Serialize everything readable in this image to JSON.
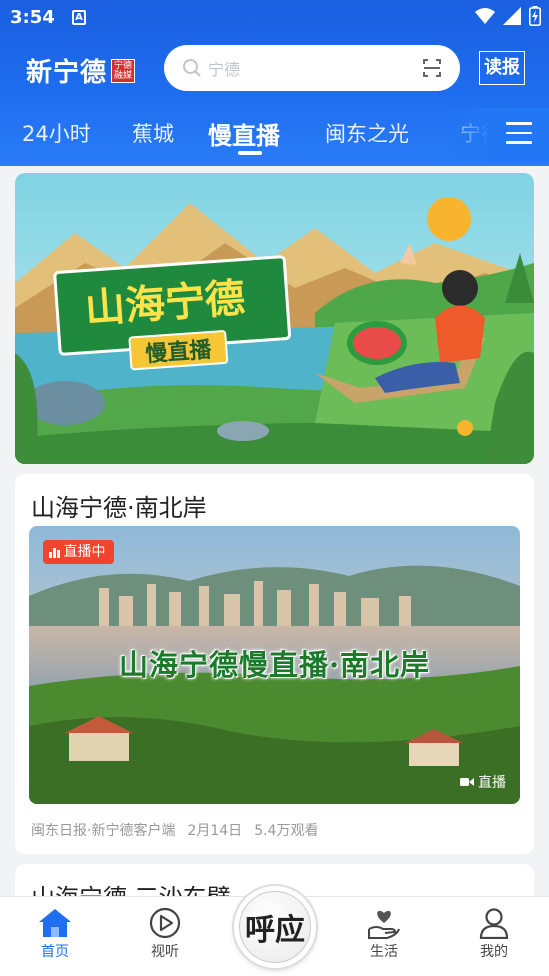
{
  "status_bar": {
    "time": "3:54",
    "notif_letter": "A"
  },
  "header": {
    "logo_text": "新宁德",
    "logo_seal": "宁德融媒",
    "search_placeholder": "宁德",
    "read_paper_label": "读报"
  },
  "tabs": [
    {
      "label": "24小时",
      "active": false
    },
    {
      "label": "蕉城",
      "active": false
    },
    {
      "label": "慢直播",
      "active": true
    },
    {
      "label": "闽东之光",
      "active": false
    },
    {
      "label": "宁德",
      "active": false
    }
  ],
  "banner": {
    "title": "山海宁德",
    "subtitle": "慢直播"
  },
  "feed": [
    {
      "title": "山海宁德·南北岸",
      "live_badge": "直播中",
      "thumb_caption": "山海宁德慢直播·南北岸",
      "video_badge": "直播",
      "source": "闽东日报·新宁德客户端",
      "date": "2月14日",
      "views": "5.4万观看"
    },
    {
      "title": "山海宁德·三沙东壁"
    }
  ],
  "bottom_nav": [
    {
      "label": "首页",
      "icon": "home-icon",
      "active": true
    },
    {
      "label": "视听",
      "icon": "play-circle-icon",
      "active": false
    },
    {
      "label": "呼应",
      "icon": "huying-center-icon",
      "active": false
    },
    {
      "label": "生活",
      "icon": "hand-heart-icon",
      "active": false
    },
    {
      "label": "我的",
      "icon": "user-icon",
      "active": false
    }
  ],
  "colors": {
    "brand_blue": "#1f6ef0",
    "live_red": "#f0442c"
  }
}
